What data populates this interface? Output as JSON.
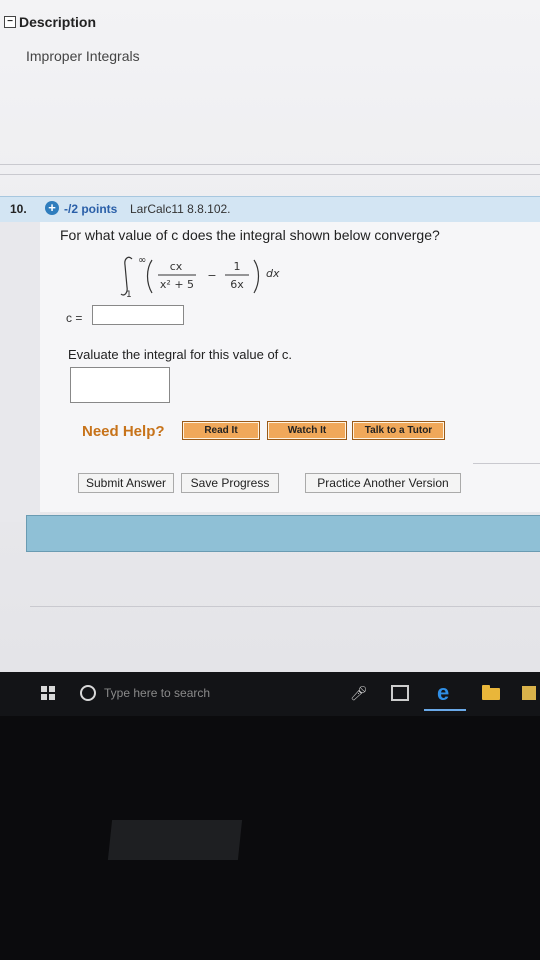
{
  "description": {
    "header": "Description",
    "subtitle": "Improper Integrals"
  },
  "question": {
    "number": "10.",
    "points": "-/2 points",
    "problem_id": "LarCalc11 8.8.102.",
    "prompt": "For what value of c does the integral shown below converge?",
    "integral": {
      "upper_limit": "∞",
      "lower_limit": "1",
      "num1": "cx",
      "den1": "x² + 5",
      "minus": "−",
      "num2": "1",
      "den2": "6x",
      "differential": "dx"
    },
    "c_label": "c =",
    "c_value": "",
    "eval_prompt": "Evaluate the integral for this value of c.",
    "eval_value": ""
  },
  "help": {
    "label": "Need Help?",
    "read_it": "Read It",
    "watch_it": "Watch It",
    "talk_to_tutor": "Talk to a Tutor"
  },
  "actions": {
    "submit": "Submit Answer",
    "save": "Save Progress",
    "practice": "Practice Another Version"
  },
  "taskbar": {
    "search_placeholder": "Type here to search"
  },
  "colors": {
    "question_bar": "#d3e5f3",
    "help_orange": "#c7731a",
    "help_button": "#f0a85a",
    "next_bar": "#8fc0d6"
  }
}
